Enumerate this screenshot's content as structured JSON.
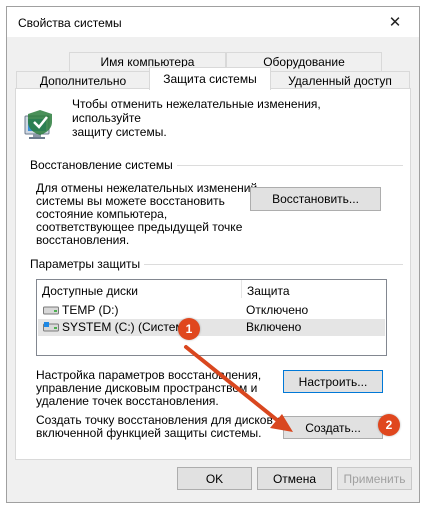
{
  "window": {
    "title": "Свойства системы",
    "close_glyph": "✕"
  },
  "tabs": {
    "row1": [
      {
        "label": "Имя компьютера"
      },
      {
        "label": "Оборудование"
      }
    ],
    "row2": [
      {
        "label": "Дополнительно"
      },
      {
        "label": "Защита системы",
        "active": true
      },
      {
        "label": "Удаленный доступ"
      }
    ]
  },
  "intro": {
    "text": "Чтобы отменить нежелательные изменения, используйте\nзащиту системы.",
    "icon": "shield-computer-icon"
  },
  "restore": {
    "group_label": "Восстановление системы",
    "description": "Для отмены нежелательных изменений\nсистемы вы можете восстановить\nсостояние компьютера,\nсоответствующее предыдущей точке\nвосстановления.",
    "button_label": "Восстановить..."
  },
  "protection": {
    "group_label": "Параметры защиты",
    "columns": [
      "Доступные диски",
      "Защита"
    ],
    "drives": [
      {
        "name": "TEMP (D:)",
        "status": "Отключено",
        "icon": "drive-icon"
      },
      {
        "name": "SYSTEM (C:) (Система)",
        "status": "Включено",
        "icon": "system-drive-icon",
        "selected": true
      }
    ],
    "configure_text": "Настройка параметров восстановления,\nуправление дисковым пространством и\nудаление точек восстановления.",
    "configure_button": "Настроить...",
    "create_text": "Создать точку восстановления для дисков с\nвключенной функцией защиты системы.",
    "create_button": "Создать..."
  },
  "annotations": {
    "badge1": "1",
    "badge2": "2",
    "badge_color": "#e0471e"
  },
  "footer": {
    "ok": "OK",
    "cancel": "Отмена",
    "apply": "Применить"
  }
}
